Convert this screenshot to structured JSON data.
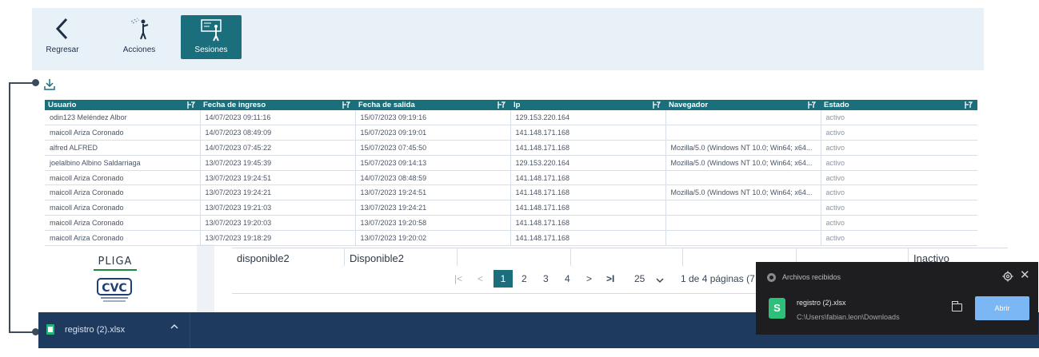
{
  "toolbar": {
    "back_label": "Regresar",
    "actions_label": "Acciones",
    "sessions_label": "Sesiones"
  },
  "table": {
    "columns": [
      "Usuario",
      "Fecha de ingreso",
      "Fecha de salida",
      "Ip",
      "Navegador",
      "Estado"
    ],
    "rows": [
      [
        "odin123 Meléndez Albor",
        "14/07/2023 09:11:16",
        "15/07/2023 09:19:16",
        "129.153.220.164",
        "",
        "activo"
      ],
      [
        "maicoll Ariza Coronado",
        "14/07/2023 08:49:09",
        "15/07/2023 09:19:01",
        "141.148.171.168",
        "",
        "activo"
      ],
      [
        "alfred ALFRED",
        "14/07/2023 07:45:22",
        "15/07/2023 07:45:50",
        "141.148.171.168",
        "Mozilla/5.0 (Windows NT 10.0; Win64; x64...",
        "activo"
      ],
      [
        "joelalbino Albino Saldarriaga",
        "13/07/2023 19:45:39",
        "15/07/2023 09:14:13",
        "129.153.220.164",
        "Mozilla/5.0 (Windows NT 10.0; Win64; x64...",
        "activo"
      ],
      [
        "maicoll Ariza Coronado",
        "13/07/2023 19:24:51",
        "14/07/2023 08:48:59",
        "141.148.171.168",
        "",
        "activo"
      ],
      [
        "maicoll Ariza Coronado",
        "13/07/2023 19:24:21",
        "13/07/2023 19:24:51",
        "141.148.171.168",
        "Mozilla/5.0 (Windows NT 10.0; Win64; x64...",
        "activo"
      ],
      [
        "maicoll Ariza Coronado",
        "13/07/2023 19:21:03",
        "13/07/2023 19:24:21",
        "141.148.171.168",
        "",
        "activo"
      ],
      [
        "maicoll Ariza Coronado",
        "13/07/2023 19:20:03",
        "13/07/2023 19:20:58",
        "141.148.171.168",
        "",
        "activo"
      ],
      [
        "maicoll Ariza Coronado",
        "13/07/2023 19:18:29",
        "13/07/2023 19:20:02",
        "141.148.171.168",
        "",
        "activo"
      ]
    ]
  },
  "logos": {
    "pliga": "PLIGA",
    "cvc": "CVC"
  },
  "panel": {
    "cell1": "disponible2",
    "cell2": "Disponible2",
    "status": "Inactivo"
  },
  "pagination": {
    "first": "|<",
    "prev": "<",
    "pages": [
      "1",
      "2",
      "3",
      "4"
    ],
    "active_page": "1",
    "next": ">",
    "last": ">I",
    "page_size": "25",
    "summary": "1 de 4 páginas (7"
  },
  "download_bar": {
    "file_name": "registro (2).xlsx",
    "chevron": "^"
  },
  "popup": {
    "title": "Archivos recibidos",
    "file_name": "registro (2).xlsx",
    "file_path": "C:\\Users\\fabian.leon\\Downloads",
    "open_label": "Abrir",
    "close_glyph": "✕",
    "file_glyph": "S"
  },
  "colors": {
    "accent": "#1b6e7c",
    "toolbar_bg": "#e9f1f8",
    "download_bar": "#1f3a5f",
    "popup_bg": "#1e1e20",
    "open_button": "#7bb6f5"
  }
}
